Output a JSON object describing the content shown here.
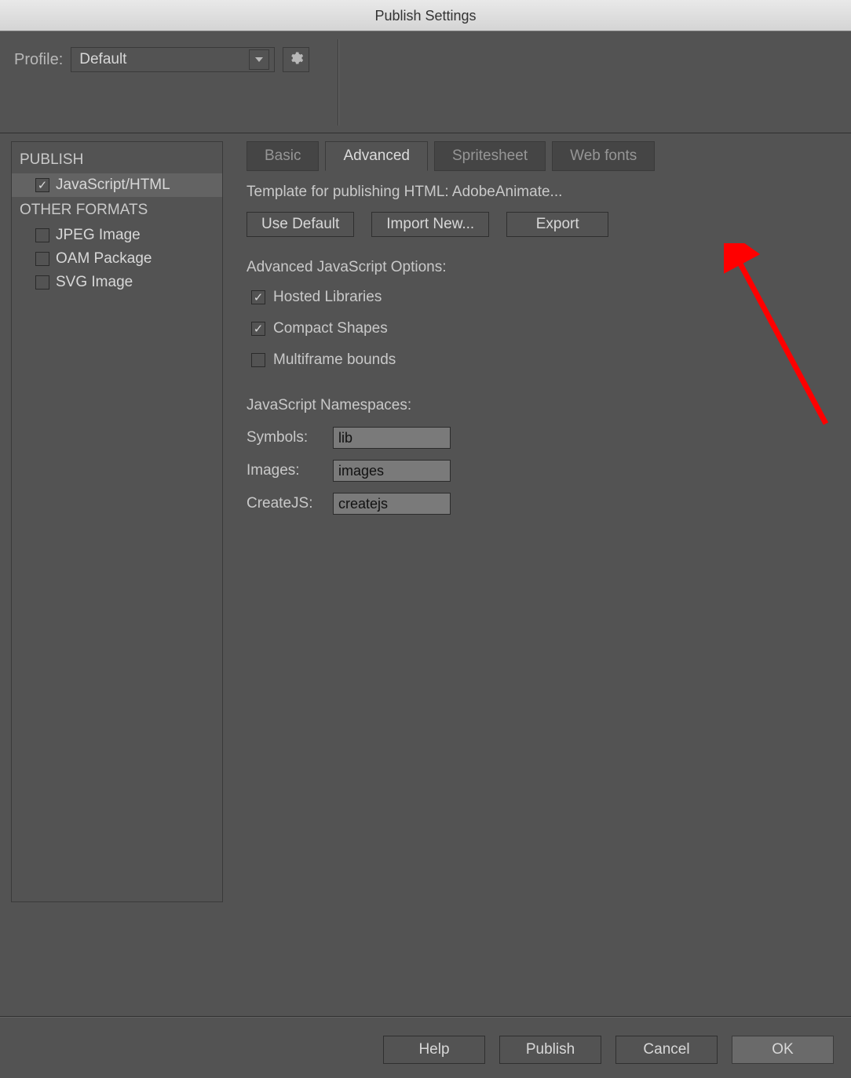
{
  "window": {
    "title": "Publish Settings"
  },
  "profile": {
    "label": "Profile:",
    "selected": "Default"
  },
  "left": {
    "publish_header": "PUBLISH",
    "other_header": "OTHER FORMATS",
    "items": [
      {
        "label": "JavaScript/HTML",
        "checked": true,
        "selected": true
      },
      {
        "label": "JPEG Image",
        "checked": false,
        "selected": false
      },
      {
        "label": "OAM Package",
        "checked": false,
        "selected": false
      },
      {
        "label": "SVG Image",
        "checked": false,
        "selected": false
      }
    ]
  },
  "tabs": [
    {
      "label": "Basic",
      "active": false
    },
    {
      "label": "Advanced",
      "active": true
    },
    {
      "label": "Spritesheet",
      "active": false
    },
    {
      "label": "Web fonts",
      "active": false
    }
  ],
  "template": {
    "label": "Template for publishing HTML: AdobeAnimate...",
    "use_default": "Use Default",
    "import_new": "Import New...",
    "export": "Export"
  },
  "advanced_js": {
    "header": "Advanced JavaScript Options:",
    "hosted_libraries": {
      "label": "Hosted Libraries",
      "checked": true
    },
    "compact_shapes": {
      "label": "Compact Shapes",
      "checked": true
    },
    "multiframe_bounds": {
      "label": "Multiframe bounds",
      "checked": false
    }
  },
  "namespaces": {
    "header": "JavaScript Namespaces:",
    "symbols": {
      "label": "Symbols:",
      "value": "lib"
    },
    "images": {
      "label": "Images:",
      "value": "images"
    },
    "createjs": {
      "label": "CreateJS:",
      "value": "createjs"
    }
  },
  "buttons": {
    "help": "Help",
    "publish": "Publish",
    "cancel": "Cancel",
    "ok": "OK"
  }
}
